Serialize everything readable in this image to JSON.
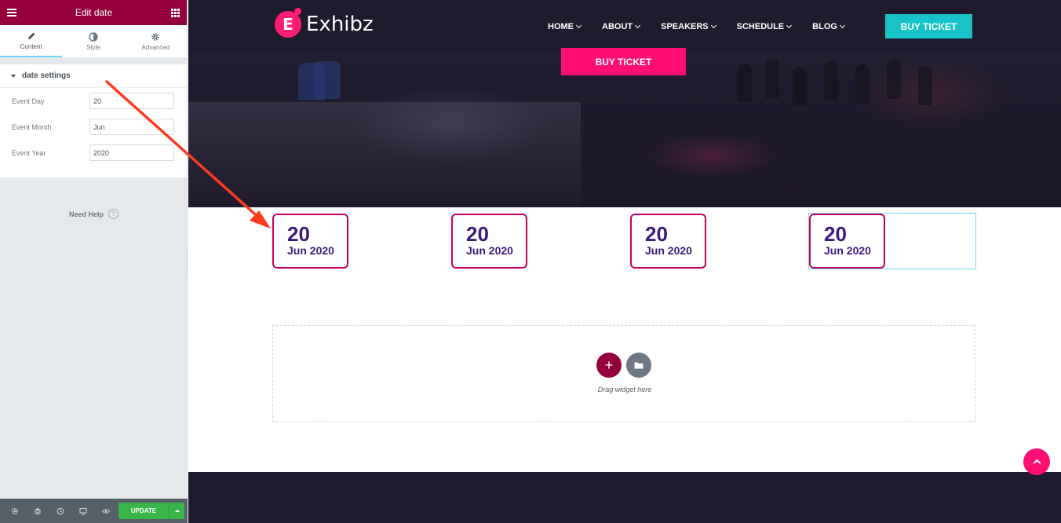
{
  "editor": {
    "title": "Edit date",
    "tabs": [
      {
        "label": "Content",
        "icon": "pencil-icon"
      },
      {
        "label": "Style",
        "icon": "contrast-icon"
      },
      {
        "label": "Advanced",
        "icon": "gear-icon"
      }
    ],
    "section_title": "date settings",
    "fields": [
      {
        "label": "Event Day",
        "value": "20"
      },
      {
        "label": "Event Month",
        "value": "Jun"
      },
      {
        "label": "Event Year",
        "value": "2020"
      }
    ],
    "need_help": "Need Help",
    "help_icon": "?",
    "update_label": "UPDATE"
  },
  "site": {
    "brand": "Exhibz",
    "logo_letter": "E",
    "nav": [
      "HOME",
      "ABOUT",
      "SPEAKERS",
      "SCHEDULE",
      "BLOG"
    ],
    "nav_button": "BUY TICKET",
    "hero_button": "BUY TICKET",
    "dates": [
      {
        "day": "20",
        "month_year": "Jun 2020"
      },
      {
        "day": "20",
        "month_year": "Jun 2020"
      },
      {
        "day": "20",
        "month_year": "Jun 2020"
      },
      {
        "day": "20",
        "month_year": "Jun 2020"
      }
    ],
    "drop_text": "Drag widget here",
    "drop_add": "+"
  },
  "colors": {
    "editor_brand": "#93003c",
    "accent_pink": "#ff0f71",
    "accent_teal": "#17c3c7",
    "date_border": "#c4005a",
    "date_text": "#3d1a7a",
    "update_green": "#39b54a"
  }
}
